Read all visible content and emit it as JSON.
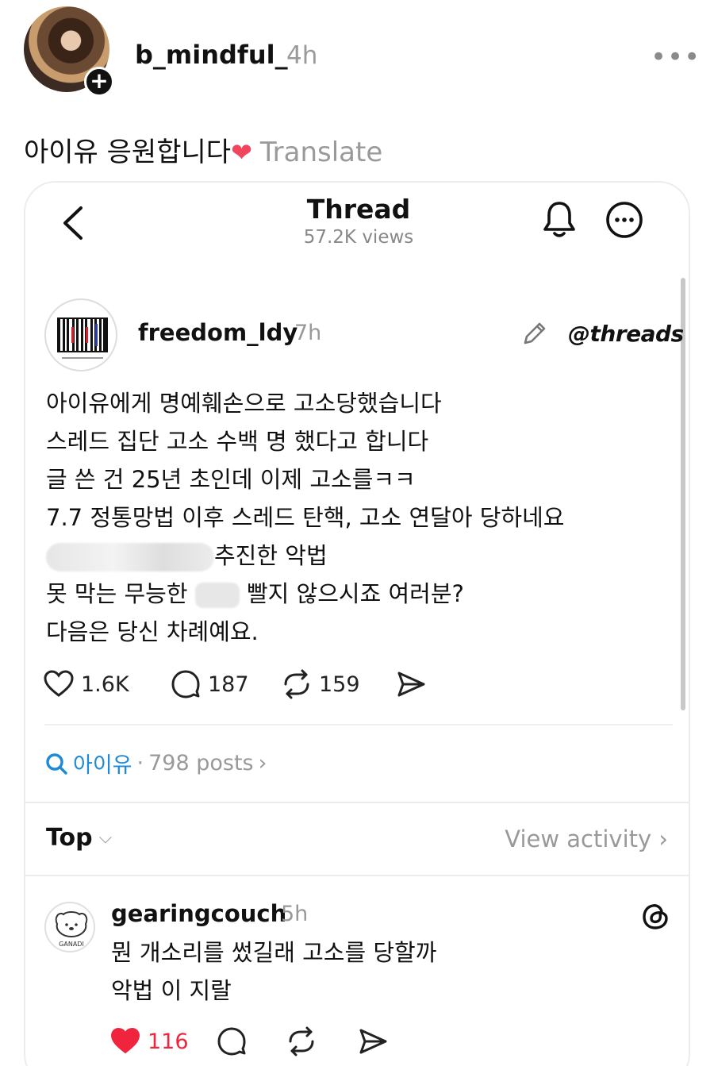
{
  "outer_post": {
    "username": "b_mindful_",
    "time": "4h",
    "more_label": "•••",
    "follow_label": "+",
    "caption": "아이유 응원합니다",
    "caption_emoji": "❤",
    "translate_label": "Translate"
  },
  "thread_screen": {
    "title": "Thread",
    "views": "57.2K views",
    "post": {
      "username": "freedom_ldy",
      "time": "7h",
      "source_logo": "threads",
      "lines": [
        "아이유에게 명예훼손으로 고소당했습니다",
        "스레드 집단 고소 수백 명 했다고 합니다",
        "글 쓴 건 25년 초인데 이제 고소를ㅋㅋ",
        "7.7 정통망법 이후 스레드 탄핵, 고소 연달아 당하네요"
      ],
      "line5_after_blur": "추진한 악법",
      "line6_before": "못 막는 무능한",
      "line6_after": "빨지 않으시죠 여러분?",
      "line7": "다음은 당신 차례예요.",
      "likes": "1.6K",
      "replies": "187",
      "reposts": "159"
    },
    "topic": {
      "name": "아이유",
      "separator": "·",
      "count": "798 posts",
      "arrow": "›"
    },
    "sort": {
      "label": "Top",
      "chevron": "⌵",
      "view_activity": "View activity  ›"
    },
    "reply": {
      "username": "gearingcouch",
      "time": "5h",
      "avatar_text": "GANADI",
      "lines": [
        "뭔 개소리를 썼길래 고소를 당할까",
        "악법 이 지랄"
      ],
      "likes": "116"
    }
  },
  "colors": {
    "accent_link": "#1d8ad7",
    "like_red": "#f0243c",
    "muted": "#999999"
  }
}
